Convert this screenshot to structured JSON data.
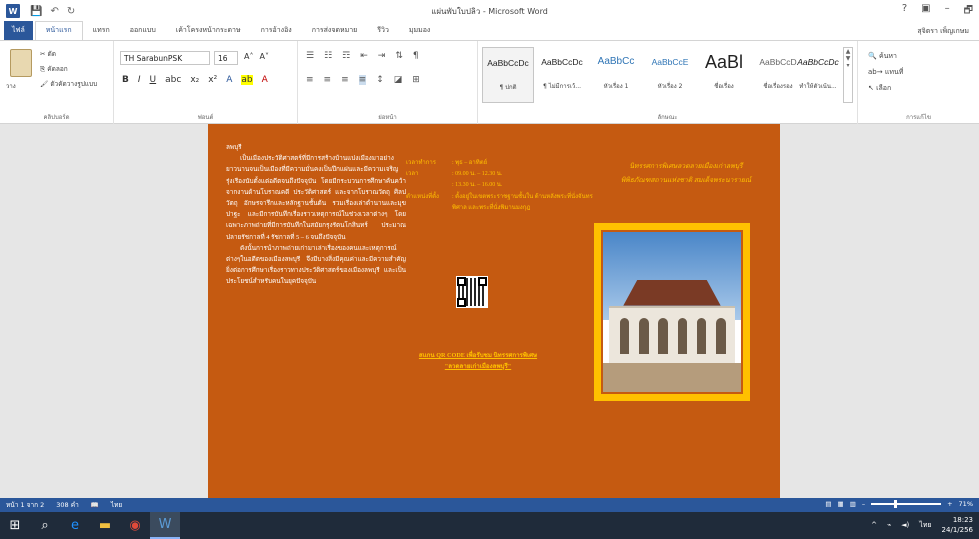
{
  "window": {
    "title": "แผ่นพับใบปลิว - Microsoft Word",
    "help": "?",
    "minimize": "–",
    "restore": "🗗"
  },
  "tabs": [
    "ไฟล์",
    "หน้าแรก",
    "แทรก",
    "ออกแบบ",
    "เค้าโครงหน้ากระดาษ",
    "การอ้างอิง",
    "การส่งจดหมาย",
    "รีวิว",
    "มุมมอง"
  ],
  "user": "สุจิตรา เพ็ญเกษม",
  "ribbon": {
    "clipboard": {
      "label": "คลิปบอร์ด",
      "paste": "วาง",
      "cut": "ตัด",
      "copy": "คัดลอก",
      "format_painter": "ตัวคัดวางรูปแบบ"
    },
    "font": {
      "label": "ฟอนต์",
      "name": "TH SarabunPSK",
      "size": "16"
    },
    "paragraph": {
      "label": "ย่อหน้า"
    },
    "styles": {
      "label": "ลักษณะ",
      "items": [
        {
          "sample": "AaBbCcDc",
          "name": "¶ ปกติ",
          "kind": "normal"
        },
        {
          "sample": "AaBbCcDc",
          "name": "¶ ไม่มีการเว้...",
          "kind": "normal"
        },
        {
          "sample": "AaBbCc",
          "name": "หัวเรื่อง 1",
          "kind": "heading"
        },
        {
          "sample": "AaBbCcE",
          "name": "หัวเรื่อง 2",
          "kind": "heading"
        },
        {
          "sample": "AaBl",
          "name": "ชื่อเรื่อง",
          "kind": "big"
        },
        {
          "sample": "AaBbCcD",
          "name": "ชื่อเรื่องรอง",
          "kind": "normal"
        },
        {
          "sample": "AaBbCcDc",
          "name": "ทำให้ตัวเน้น...",
          "kind": "normal"
        }
      ]
    },
    "editing": {
      "label": "การแก้ไข",
      "find": "ค้นหา",
      "replace": "แทนที่",
      "select": "เลือก"
    }
  },
  "document": {
    "col1_heading": "ลพบุรี",
    "col1_para1": "เป็นเมืองประวัติศาสตร์ที่มีการสร้างบ้านแปงเมืองมาอย่างยาวนานจนเป็นเมืองที่มีความมั่นคงเป็นปึกแผ่นและมีความเจริญรุ่งเรืองนับตั้งแต่อดีตจนถึงปัจจุบัน โดยมีกระบวนการศึกษาค้นคว้าจากงานด้านโบราณคดี ประวัติศาสตร์ และจากโบราณวัตถุ ศิลปวัตถุ อักษรจารึกและหลักฐานชั้นต้น รวมเรื่องเล่าตำนานและมุขปาฐะ และมีการบันทึกเรื่องราวเหตุการณ์ในช่วงเวลาต่างๆ โดยเฉพาะภาพถ่ายที่มีการบันทึกในสมัยกรุงรัตนโกสินทร์ ประมาณปลายรัชกาลที่ 4 รัชกาลที่ 5 – 6 จนถึงปัจจุบัน",
    "col1_para2": "ดังนั้นการนำภาพถ่ายเก่ามาเล่าเรื่องของคนและเหตุการณ์ต่างๆในอดีตของเมืองลพบุรี จึงมีบางสิ่งมีคุณค่าและมีความสำคัญยิ่งต่อการศึกษาเรื่องราวทางประวัติศาสตร์ของเมืองลพบุรี และเป็นประโยชน์สำหรับคนในยุคปัจจุบัน",
    "schedule": [
      {
        "label": "เวลาทำการ",
        "value": ": พุธ – อาทิตย์"
      },
      {
        "label": "เวลา",
        "value": ": 09.00 น. – 12.30 น."
      },
      {
        "label": "",
        "value": ": 13.30 น. – 16.00 น."
      },
      {
        "label": "ตำแหน่งที่ตั้ง",
        "value": ": ตั้งอยู่ในเขตพระราชฐานชั้นใน ด้านหลังพระที่นั่งจันทรพิศาล และพระที่นั่งพิมานมงกุฎ"
      }
    ],
    "scan_text_1": "สแกน QR CODE เพื่อรับชม นิทรรศการพิเศษ",
    "scan_text_2": "\"ลวดลายเก่าเมืองลพบุรี\"",
    "col3_heading_1": "นิทรรศการพิเศษลวดลายเมืองเก่าลพบุรี",
    "col3_heading_2": "พิพิธภัณฑสถานแห่งชาติ สมเด็จพระนารายณ์"
  },
  "statusbar": {
    "page": "หน้า 1 จาก 2",
    "words": "308 คำ",
    "language": "ไทย",
    "zoom": "71%",
    "zoom_level": 0.71
  },
  "taskbar": {
    "language": "ไทย",
    "time": "18:23",
    "date": "24/1/256"
  },
  "colors": {
    "accent": "#2b579a",
    "page_bg": "#c55a11",
    "highlight": "#ffc000"
  }
}
